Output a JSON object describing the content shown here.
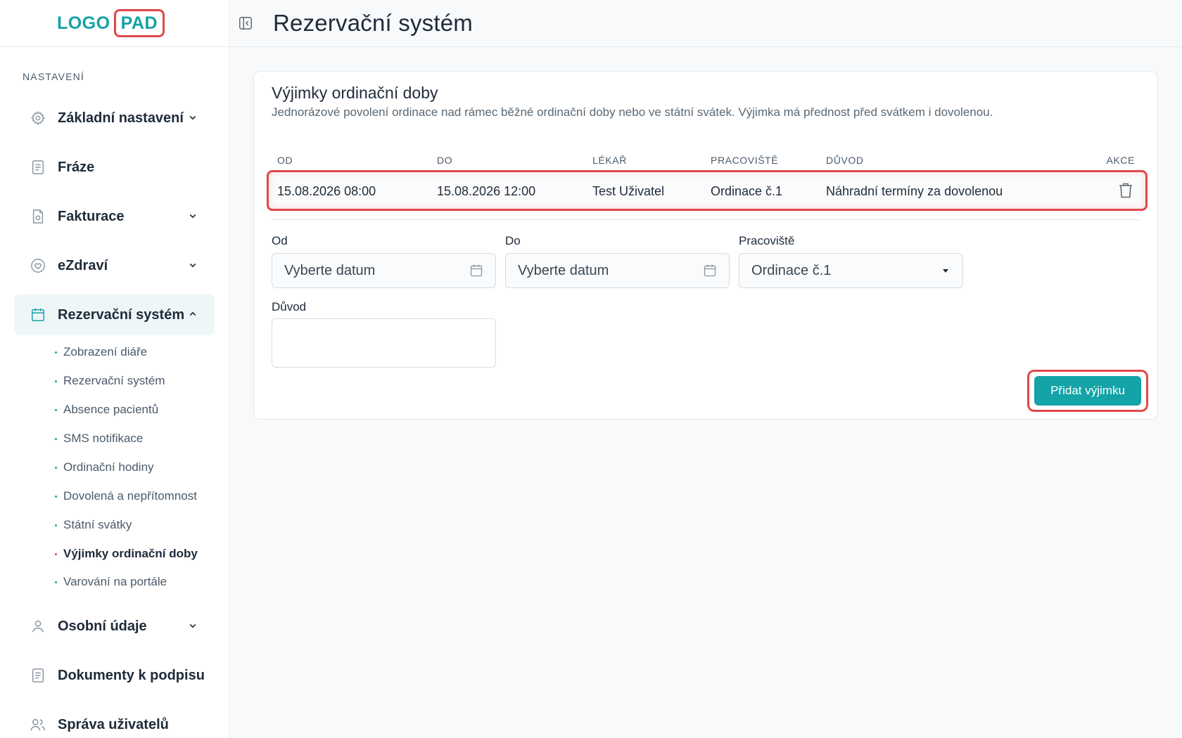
{
  "logo": {
    "left": "LOGO",
    "right": "PAD"
  },
  "header": {
    "title": "Rezervační systém"
  },
  "sidebar": {
    "section_label": "NASTAVENÍ",
    "items": [
      {
        "label": "Základní nastavení",
        "icon": "gear-icon",
        "expandable": true,
        "expanded": false
      },
      {
        "label": "Fráze",
        "icon": "document-icon",
        "expandable": false
      },
      {
        "label": "Fakturace",
        "icon": "invoice-icon",
        "expandable": true,
        "expanded": false
      },
      {
        "label": "eZdraví",
        "icon": "heart-icon",
        "expandable": true,
        "expanded": false
      },
      {
        "label": "Rezervační systém",
        "icon": "calendar-icon",
        "expandable": true,
        "expanded": true,
        "active": true
      },
      {
        "label": "Osobní údaje",
        "icon": "user-icon",
        "expandable": true,
        "expanded": false
      },
      {
        "label": "Dokumenty k podpisu",
        "icon": "document-icon",
        "expandable": false
      },
      {
        "label": "Správa uživatelů",
        "icon": "users-icon",
        "expandable": false
      }
    ],
    "subitems": [
      {
        "label": "Zobrazení diáře"
      },
      {
        "label": "Rezervační systém"
      },
      {
        "label": "Absence pacientů"
      },
      {
        "label": "SMS notifikace"
      },
      {
        "label": "Ordinační hodiny"
      },
      {
        "label": "Dovolená a nepřítomnost"
      },
      {
        "label": "Státní svátky"
      },
      {
        "label": "Výjimky ordinační doby",
        "active": true
      },
      {
        "label": "Varování na portále"
      }
    ]
  },
  "card": {
    "title": "Výjimky ordinační doby",
    "description": "Jednorázové povolení ordinace nad rámec běžné ordinační doby nebo ve státní svátek. Výjimka má přednost před svátkem i dovolenou.",
    "table": {
      "headers": [
        "OD",
        "DO",
        "LÉKAŘ",
        "PRACOVIŠTĚ",
        "DŮVOD",
        "AKCE"
      ],
      "rows": [
        [
          "15.08.2026 08:00",
          "15.08.2026 12:00",
          "Test Uživatel",
          "Ordinace č.1",
          "Náhradní termíny za dovolenou"
        ]
      ]
    },
    "form": {
      "od_label": "Od",
      "od_placeholder": "Vyberte datum",
      "do_label": "Do",
      "do_placeholder": "Vyberte datum",
      "pracoviste_label": "Pracoviště",
      "pracoviste_value": "Ordinace č.1",
      "duvod_label": "Důvod",
      "duvod_value": "",
      "submit_label": "Přidat výjimku"
    }
  },
  "colors": {
    "accent": "#14a3a6",
    "highlight": "#e0484a",
    "text": "#1e2b3a"
  }
}
